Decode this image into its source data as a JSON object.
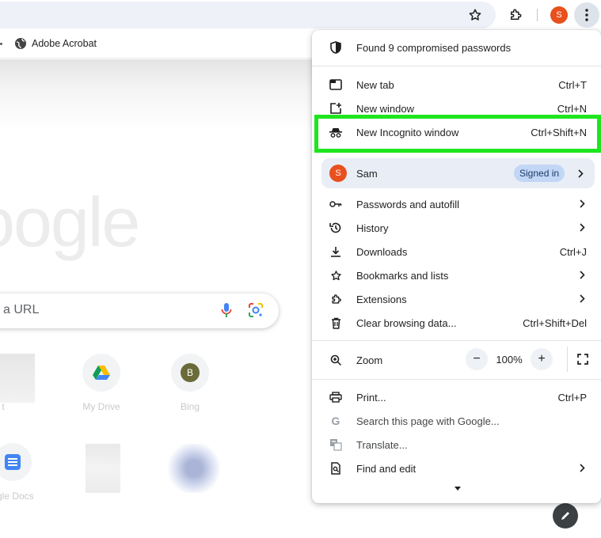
{
  "bookmarks": {
    "item": "Adobe Acrobat"
  },
  "page": {
    "logo_text": "oogle",
    "search_placeholder": "a URL",
    "shortcuts": [
      {
        "label": "t"
      },
      {
        "label": "My Drive"
      },
      {
        "label": "Bing",
        "initial": "B"
      },
      {
        "label": "ogle Docs"
      }
    ]
  },
  "profile": {
    "initial": "S"
  },
  "menu": {
    "compromised": "Found 9 compromised passwords",
    "new_tab": {
      "label": "New tab",
      "shortcut": "Ctrl+T"
    },
    "new_window": {
      "label": "New window",
      "shortcut": "Ctrl+N"
    },
    "new_incognito": {
      "label": "New Incognito window",
      "shortcut": "Ctrl+Shift+N"
    },
    "profile": {
      "name": "Sam",
      "initial": "S",
      "badge": "Signed in"
    },
    "passwords": "Passwords and autofill",
    "history": "History",
    "downloads": {
      "label": "Downloads",
      "shortcut": "Ctrl+J"
    },
    "bookmarks": "Bookmarks and lists",
    "extensions": "Extensions",
    "clear": {
      "label": "Clear browsing data...",
      "shortcut": "Ctrl+Shift+Del"
    },
    "zoom": {
      "label": "Zoom",
      "value": "100%",
      "minus": "−",
      "plus": "+"
    },
    "print": {
      "label": "Print...",
      "shortcut": "Ctrl+P"
    },
    "search_page": "Search this page with Google...",
    "translate": "Translate...",
    "find_edit": "Find and edit"
  },
  "colors": {
    "highlight": "#1ee51e",
    "avatar": "#e8501d",
    "signed_in_badge": "#c2d7f5"
  }
}
